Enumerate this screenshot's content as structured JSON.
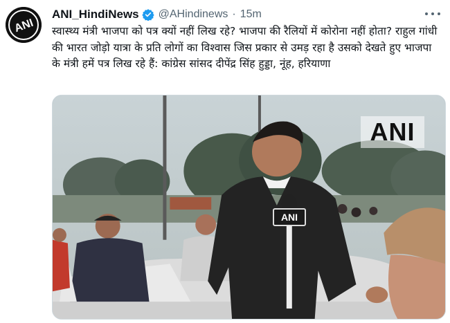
{
  "account": {
    "display_name": "ANI_HindiNews",
    "handle": "@AHindinews",
    "separator": "·",
    "time": "15m",
    "avatar_text": "ANI",
    "verified_color": "#1d9bf0"
  },
  "tweet": {
    "text": "स्वास्थ्य मंत्री भाजपा को पत्र क्यों नहीं लिख रहे? भाजपा की रैलियों में कोरोना नहीं होता? राहुल गांधी की भारत जोड़ो यात्रा के प्रति लोगों का विश्वास जिस प्रकार से उमड़ रहा है उसको देखते हुए भाजपा के मंत्री हमें पत्र लिख रहे हैं: कांग्रेस सांसद दीपेंद्र सिंह हुड्डा, नूंह, हरियाणा"
  },
  "media": {
    "watermark": "ANI",
    "mic_label": "ANI"
  },
  "icons": {
    "more": "more-options-icon",
    "verified": "verified-badge-icon"
  }
}
